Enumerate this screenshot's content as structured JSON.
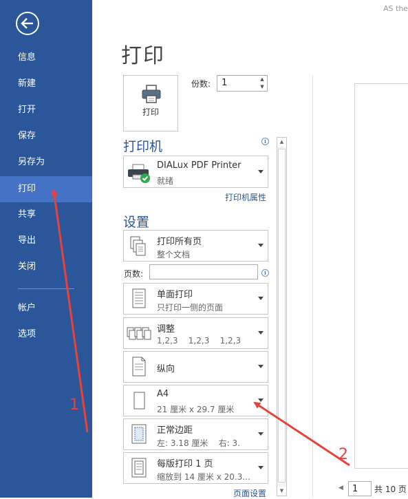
{
  "top_right_text": "AS the",
  "sidebar": {
    "items": [
      {
        "label": "信息"
      },
      {
        "label": "新建"
      },
      {
        "label": "打开"
      },
      {
        "label": "保存"
      },
      {
        "label": "另存为"
      },
      {
        "label": "打印",
        "active": true
      },
      {
        "label": "共享"
      },
      {
        "label": "导出"
      },
      {
        "label": "关闭"
      },
      {
        "label": "帐户"
      },
      {
        "label": "选项"
      }
    ]
  },
  "main": {
    "title": "打印",
    "print_button_label": "打印",
    "copies_label": "份数:",
    "copies_value": "1",
    "printer": {
      "heading": "打印机",
      "name": "DIALux PDF Printer",
      "status": "就绪",
      "properties_link": "打印机属性"
    },
    "settings": {
      "heading": "设置",
      "range": {
        "title": "打印所有页",
        "subtitle": "整个文档"
      },
      "pages_label": "页数:",
      "sides": {
        "title": "单面打印",
        "subtitle": "只打印一侧的页面"
      },
      "collate": {
        "title": "调整",
        "subtitle": "1,2,3    1,2,3    1,2,3"
      },
      "orientation": {
        "title": "纵向"
      },
      "paper": {
        "title": "A4",
        "subtitle": "21 厘米 x 29.7 厘米"
      },
      "margins": {
        "title": "正常边距",
        "subtitle": "左: 3.18 厘米    右: 3."
      },
      "per_sheet": {
        "title": "每版打印 1 页",
        "subtitle": "缩放到 14 厘米 x 20.3..."
      },
      "page_setup_link": "页面设置"
    },
    "preview": {
      "page_value": "1",
      "total_text": "共 10 页"
    }
  },
  "annotations": {
    "label1": "1",
    "label2": "2",
    "color": "#e8423a"
  },
  "colors": {
    "sidebar": "#2b579a",
    "sidebar_active": "#4472c4",
    "accent": "#2b579a"
  }
}
